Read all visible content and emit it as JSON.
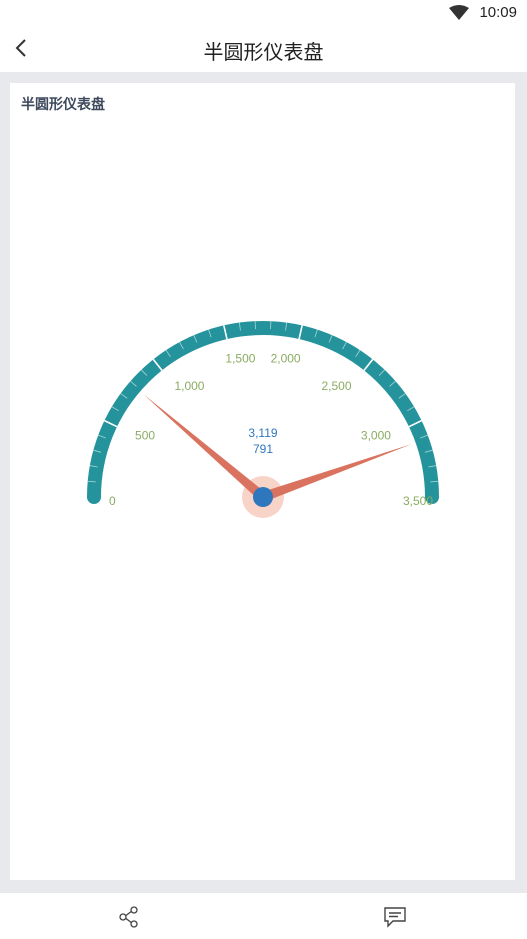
{
  "status_bar": {
    "time": "10:09",
    "wifi_icon": "wifi-icon"
  },
  "app_bar": {
    "back_icon": "back-arrow-icon",
    "title": "半圆形仪表盘"
  },
  "card": {
    "title": "半圆形仪表盘"
  },
  "chart_data": {
    "type": "gauge",
    "min": 0,
    "max": 3500,
    "tick_labels": [
      "0",
      "500",
      "1,000",
      "1,500",
      "2,000",
      "2,500",
      "3,000",
      "3,500"
    ],
    "tick_values": [
      0,
      500,
      1000,
      1500,
      2000,
      2500,
      3000,
      3500
    ],
    "needles": [
      {
        "value": 3119,
        "label": "3,119"
      },
      {
        "value": 791,
        "label": "791"
      }
    ],
    "colors": {
      "band": "#25939c",
      "tick_label": "#8aab62",
      "needle": "#d9735f",
      "pivot": "#2f77bd",
      "pivot_halo": "#f8d3c8",
      "value_text": "#2f77bd"
    }
  },
  "bottom_bar": {
    "share_icon": "share-icon",
    "comment_icon": "comment-icon"
  }
}
